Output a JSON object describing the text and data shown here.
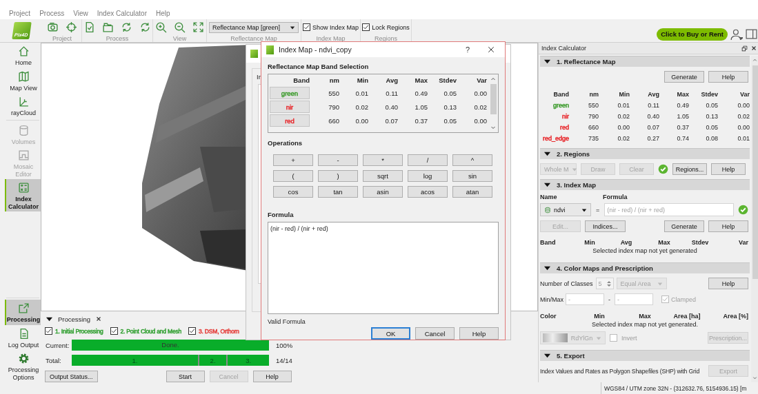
{
  "menu": [
    "Project",
    "Process",
    "View",
    "Index Calculator",
    "Help"
  ],
  "toolbar": {
    "logo": "Pix4D",
    "groups": [
      {
        "kind": "tools",
        "label": "Project"
      },
      {
        "kind": "tools",
        "label": "Process"
      },
      {
        "kind": "tools",
        "label": "View"
      },
      {
        "kind": "select",
        "label": "Reflectance Map",
        "value": "Reflectance Map [green]"
      },
      {
        "kind": "checkbox",
        "label": "Index Map",
        "text": "Show Index Map",
        "checked": true
      },
      {
        "kind": "checkbox",
        "label": "Regions",
        "text": "Lock Regions",
        "checked": true
      }
    ],
    "buy_button": "Click to Buy or Rent"
  },
  "sidebar": {
    "top": [
      {
        "label": "Home",
        "disabled": false,
        "selected": false
      },
      {
        "label": "Map View",
        "disabled": false,
        "selected": false
      },
      {
        "label": "rayCloud",
        "disabled": false,
        "selected": false
      },
      {
        "label": "Volumes",
        "disabled": true,
        "selected": false
      },
      {
        "label": "Mosaic Editor",
        "disabled": true,
        "selected": false
      },
      {
        "label": "Index Calculator",
        "disabled": false,
        "selected": true
      }
    ],
    "bottom": [
      {
        "label": "Processing",
        "disabled": false,
        "selected": true
      },
      {
        "label": "Log Output",
        "disabled": false,
        "selected": false
      },
      {
        "label": "Processing Options",
        "disabled": false,
        "selected": false
      }
    ]
  },
  "processing": {
    "title": "Processing",
    "expanded": true,
    "steps": [
      {
        "label": "1. Initial Processing",
        "checked": true,
        "color": "#2e9e2e"
      },
      {
        "label": "2. Point Cloud and Mesh",
        "checked": true,
        "color": "#2e9e2e"
      },
      {
        "label": "3. DSM, Orthom",
        "checked": true,
        "color": "#e53935"
      }
    ],
    "current": {
      "label": "Current:",
      "text": "Done.",
      "level": 1,
      "reading": "100%"
    },
    "total": {
      "label": "Total:",
      "segments": [
        "1.",
        "2.",
        "3."
      ],
      "level": 1,
      "reading": "14/14"
    },
    "buttons": [
      {
        "label": "Output Status...",
        "disabled": false
      },
      {
        "label": "Start",
        "disabled": false
      },
      {
        "label": "Cancel",
        "disabled": true
      },
      {
        "label": "Help",
        "disabled": false
      }
    ]
  },
  "background_dialog": {
    "label": "In"
  },
  "dialog": {
    "title": "Index Map - ndvi_copy",
    "help_button": "?",
    "band_section": "Reflectance Map Band Selection",
    "columns": [
      "Band",
      "nm",
      "Min",
      "Avg",
      "Max",
      "Stdev",
      "Var"
    ],
    "rows": [
      {
        "band": "green",
        "color": "#3a9a2a",
        "values": [
          "550",
          "0.01",
          "0.11",
          "0.49",
          "0.05",
          "0.00"
        ]
      },
      {
        "band": "nir",
        "color": "#e8262a",
        "values": [
          "790",
          "0.02",
          "0.40",
          "1.05",
          "0.13",
          "0.02"
        ]
      },
      {
        "band": "red",
        "color": "#e8262a",
        "values": [
          "660",
          "0.00",
          "0.07",
          "0.37",
          "0.05",
          "0.00"
        ]
      }
    ],
    "operations_title": "Operations",
    "operations": [
      "+",
      "-",
      "*",
      "/",
      "^",
      "(",
      ")",
      "sqrt",
      "log",
      "sin",
      "cos",
      "tan",
      "asin",
      "acos",
      "atan"
    ],
    "formula_title": "Formula",
    "formula": "(nir - red) / (nir + red)",
    "status": "Valid Formula",
    "buttons": [
      {
        "label": "OK",
        "default": true
      },
      {
        "label": "Cancel",
        "default": false
      },
      {
        "label": "Help",
        "default": false
      }
    ]
  },
  "index_panel": {
    "title": "Index Calculator",
    "reflectance": {
      "title": "1. Reflectance Map",
      "expanded": true,
      "buttons": [
        {
          "label": "Generate",
          "disabled": false
        },
        {
          "label": "Help",
          "disabled": false
        }
      ],
      "columns": [
        "Band",
        "nm",
        "Min",
        "Avg",
        "Max",
        "Stdev",
        "Var"
      ],
      "rows": [
        {
          "band": "green",
          "color": "#3a9a2a",
          "values": [
            "550",
            "0.01",
            "0.11",
            "0.49",
            "0.05",
            "0.00"
          ]
        },
        {
          "band": "nir",
          "color": "#e8262a",
          "values": [
            "790",
            "0.02",
            "0.40",
            "1.05",
            "0.13",
            "0.02"
          ]
        },
        {
          "band": "red",
          "color": "#e8262a",
          "values": [
            "660",
            "0.00",
            "0.07",
            "0.37",
            "0.05",
            "0.00"
          ]
        },
        {
          "band": "red_edge",
          "color": "#e8262a",
          "values": [
            "735",
            "0.02",
            "0.27",
            "0.74",
            "0.08",
            "0.01"
          ]
        }
      ]
    },
    "regions": {
      "title": "2. Regions",
      "expanded": true,
      "region": {
        "value": "Whole M",
        "disabled": true
      },
      "buttons": [
        {
          "label": "Draw",
          "disabled": true
        },
        {
          "label": "Clear",
          "disabled": true
        }
      ],
      "valid": true,
      "more_buttons": [
        {
          "label": "Regions...",
          "disabled": false
        },
        {
          "label": "Help",
          "disabled": false
        }
      ]
    },
    "index_map": {
      "title": "3. Index Map",
      "expanded": true,
      "name_label": "Name",
      "formula_label": "Formula",
      "name": "ndvi",
      "equals": "=",
      "formula": "(nir - red) / (nir + red)",
      "valid": true,
      "left_buttons": [
        {
          "label": "Edit...",
          "disabled": true
        },
        {
          "label": "Indices...",
          "disabled": false
        }
      ],
      "right_buttons": [
        {
          "label": "Generate",
          "disabled": false
        },
        {
          "label": "Help",
          "disabled": false
        }
      ],
      "columns": [
        "Band",
        "Min",
        "Avg",
        "Max",
        "Stdev",
        "Var"
      ],
      "message": "Selected index map not yet generated"
    },
    "color_maps": {
      "title": "4. Color Maps and Prescription",
      "expanded": true,
      "classes_label": "Number of Classes",
      "classes": {
        "value": "5",
        "disabled": true
      },
      "method": {
        "value": "Equal Area",
        "disabled": true
      },
      "help": {
        "label": "Help",
        "disabled": false
      },
      "minmax_label": "Min/Max",
      "min": "-",
      "separator": "-",
      "max": "-",
      "clamped": {
        "label": "Clamped",
        "checked": true,
        "disabled": true
      },
      "columns": [
        "Color",
        "Min",
        "Max",
        "Area [ha]",
        "Area [%]"
      ],
      "message": "Selected index map not yet generated.",
      "colormap": {
        "value": "RdYlGn",
        "disabled": true
      },
      "invert": {
        "label": "Invert",
        "checked": false
      },
      "prescription": {
        "label": "Prescription...",
        "disabled": true
      }
    },
    "export": {
      "title": "5. Export",
      "expanded": true,
      "text": "Index Values and Rates as Polygon Shapefiles (SHP) with Grid",
      "button": {
        "label": "Export",
        "disabled": true
      }
    }
  },
  "status_bar": "WGS84 / UTM zone 32N - (312632.76, 5154936.15) [m"
}
